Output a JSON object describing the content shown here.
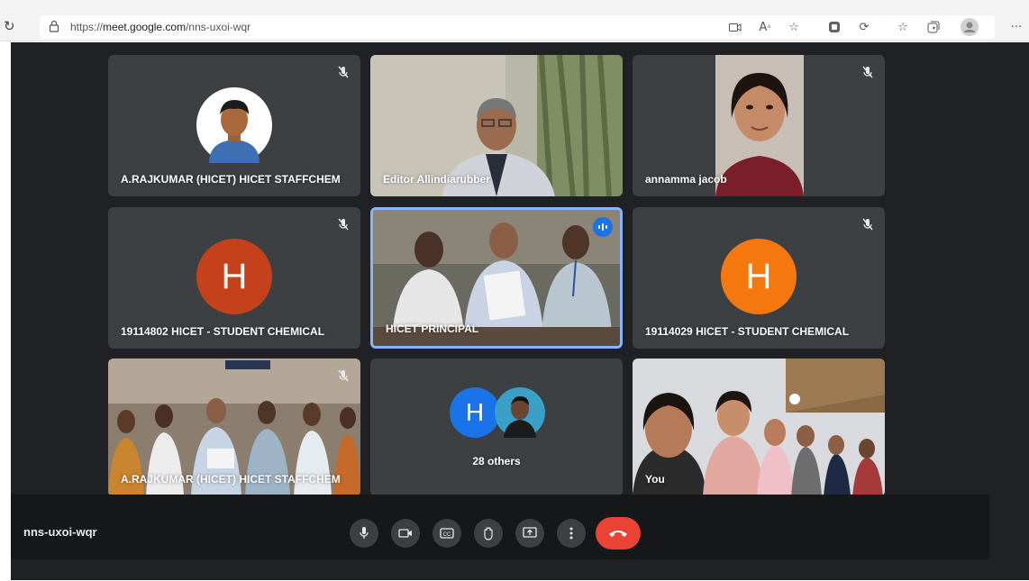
{
  "browser": {
    "url_scheme": "https://",
    "url_host": "meet.google.com",
    "url_path": "/nns-uxoi-wqr",
    "icons": [
      "refresh-icon",
      "lock-icon",
      "camera-icon",
      "read-aloud-icon",
      "favorite-star-icon",
      "extension-icon",
      "sync-icon",
      "favorites-icon",
      "collections-icon",
      "profile-icon",
      "more-icon"
    ]
  },
  "tiles": [
    {
      "name": "A.RAJKUMAR (HICET) HICET STAFFCHEM",
      "muted": true
    },
    {
      "name": "Editor Allindiarubber",
      "muted": false
    },
    {
      "name": "annamma jacob",
      "muted": true
    },
    {
      "name": "19114802 HICET - STUDENT CHEMICAL",
      "muted": true,
      "avatar_letter": "H",
      "avatar_color": "#c5411b"
    },
    {
      "name": "HICET PRINCIPAL",
      "muted": false,
      "speaking": true
    },
    {
      "name": "19114029 HICET - STUDENT CHEMICAL",
      "muted": true,
      "avatar_letter": "H",
      "avatar_color": "#f5780f"
    },
    {
      "name": "A.RAJKUMAR (HICET) HICET STAFFCHEM",
      "muted": true
    },
    {
      "name": "28 others",
      "avatar_letter": "H",
      "avatar_color": "#1a73e8"
    },
    {
      "name": "You",
      "muted": false
    }
  ],
  "controls": {
    "meeting_code": "nns-uxoi-wqr",
    "buttons": [
      "microphone-icon",
      "camera-icon",
      "captions-icon",
      "raise-hand-icon",
      "present-icon",
      "more-options-icon",
      "end-call-icon"
    ]
  },
  "colors": {
    "meet_bg": "#202124",
    "tile_bg": "#3c4043",
    "end_call": "#ea4335",
    "active_speaker": "#8ab4f8"
  }
}
